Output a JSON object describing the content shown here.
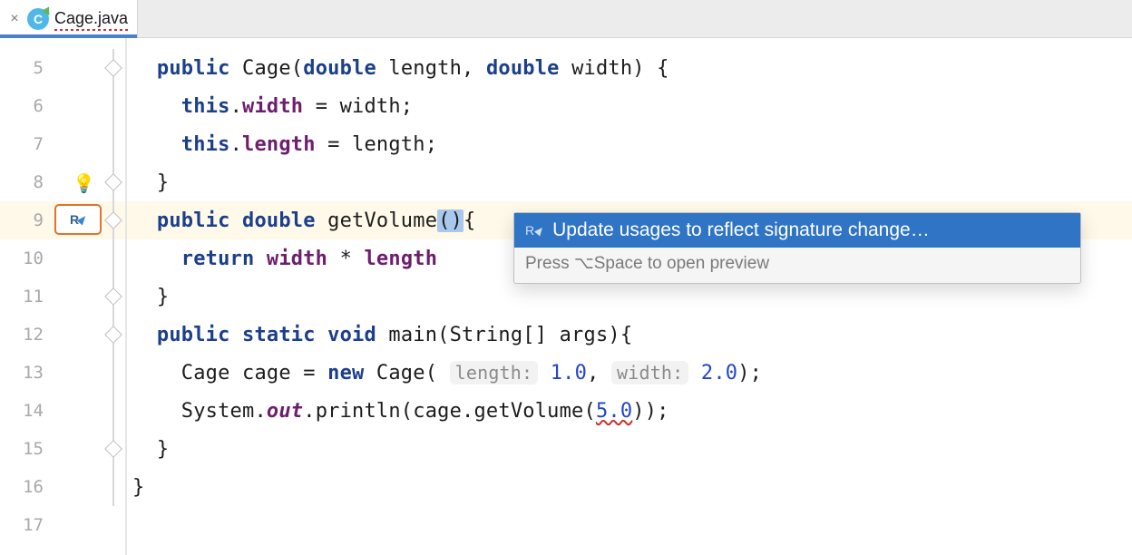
{
  "tab": {
    "title": "Cage.java",
    "file_icon_letter": "C",
    "close_glyph": "×"
  },
  "gutter": {
    "numbers": [
      "5",
      "6",
      "7",
      "8",
      "9",
      "10",
      "11",
      "12",
      "13",
      "14",
      "15",
      "16",
      "17"
    ]
  },
  "icons": {
    "bulb": "💡",
    "run": "▶",
    "r_glyph": "R"
  },
  "code": {
    "l5_indent": "  ",
    "l5_kw1": "public",
    "l5_sp1": " ",
    "l5_name": "Cage(",
    "l5_kw2": "double",
    "l5_sp2": " ",
    "l5_p1": "length, ",
    "l5_kw3": "double",
    "l5_sp3": " ",
    "l5_p2": "width) {",
    "l6_indent": "    ",
    "l6_kw": "this",
    "l6_dot": ".",
    "l6_field": "width",
    "l6_rest": " = width;",
    "l7_indent": "    ",
    "l7_kw": "this",
    "l7_dot": ".",
    "l7_field": "length",
    "l7_rest": " = length;",
    "l8_indent": "  ",
    "l8_rest": "}",
    "l9_indent": "  ",
    "l9_kw1": "public",
    "l9_sp1": " ",
    "l9_kw2": "double",
    "l9_sp2": " ",
    "l9_name": "getVolume",
    "l9_paren": "()",
    "l9_brace": "{",
    "l10_indent": "    ",
    "l10_kw": "return",
    "l10_sp": " ",
    "l10_f1": "width",
    "l10_mid": " * ",
    "l10_f2": "length",
    "l11_indent": "  ",
    "l11_rest": "}",
    "l12_indent": "  ",
    "l12_kw1": "public",
    "l12_sp1": " ",
    "l12_kw2": "static",
    "l12_sp2": " ",
    "l12_kw3": "void",
    "l12_sp3": " ",
    "l12_rest": "main(String[] args){",
    "l13_indent": "    ",
    "l13_a": "Cage cage = ",
    "l13_kw": "new",
    "l13_b": " Cage( ",
    "l13_hint1": "length:",
    "l13_sp1": " ",
    "l13_num1": "1.0",
    "l13_mid": ", ",
    "l13_hint2": "width:",
    "l13_sp2": " ",
    "l13_num2": "2.0",
    "l13_end": ");",
    "l14_indent": "    ",
    "l14_a": "System.",
    "l14_out": "out",
    "l14_b": ".println(cage.getVolume(",
    "l14_arg": "5.0",
    "l14_end": "));",
    "l15_indent": "  ",
    "l15_rest": "}",
    "l16_indent": "",
    "l16_rest": "}"
  },
  "popup": {
    "label": "Update usages to reflect signature change…",
    "hint": "Press ⌥Space to open preview"
  }
}
